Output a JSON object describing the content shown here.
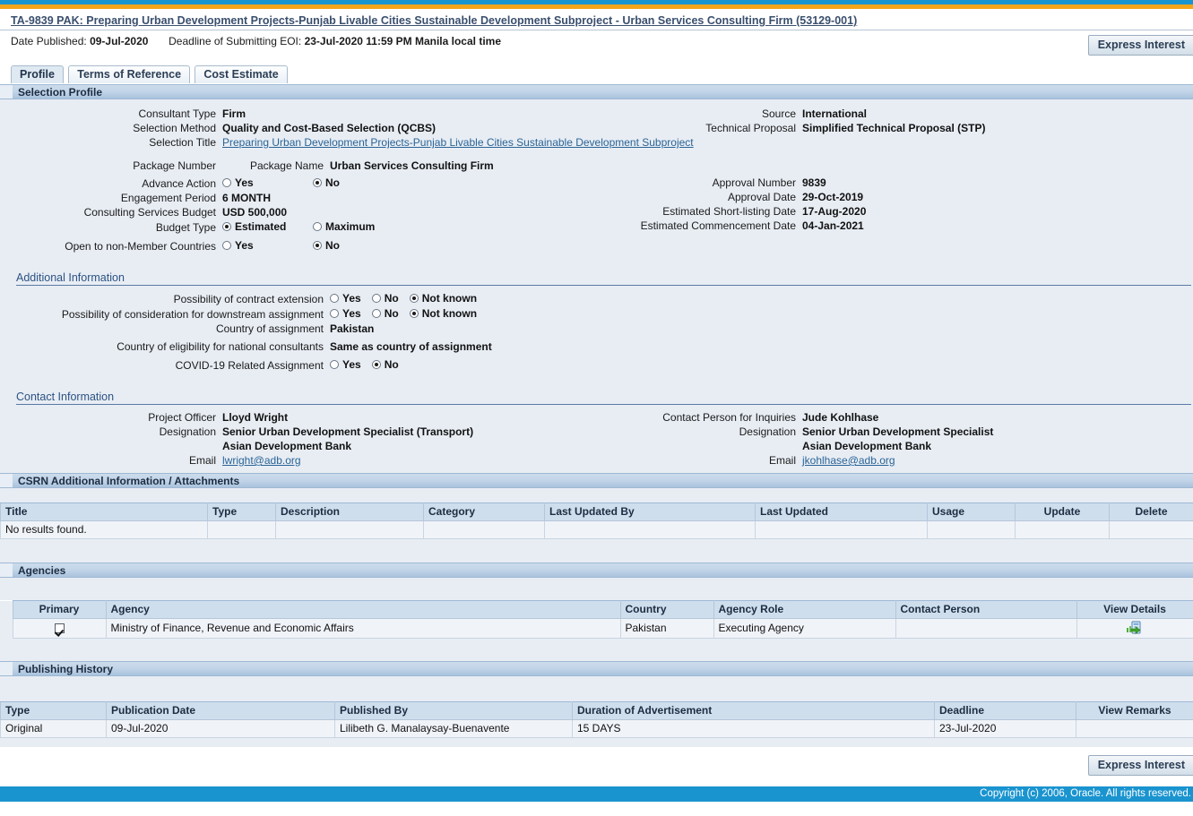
{
  "header": {
    "title": "TA-9839 PAK: Preparing Urban Development Projects-Punjab Livable Cities Sustainable Development Subproject - Urban Services Consulting Firm (53129-001)",
    "date_published_label": "Date Published:",
    "date_published_value": "09-Jul-2020",
    "deadline_label": "Deadline of Submitting EOI:",
    "deadline_value": "23-Jul-2020 11:59 PM Manila local time",
    "express_interest": "Express Interest"
  },
  "tabs": [
    {
      "label": "Profile",
      "active": true
    },
    {
      "label": "Terms of Reference",
      "active": false
    },
    {
      "label": "Cost Estimate",
      "active": false
    }
  ],
  "selection_profile": {
    "band": "Selection Profile",
    "left": {
      "consultant_type_label": "Consultant Type",
      "consultant_type_value": "Firm",
      "selection_method_label": "Selection Method",
      "selection_method_value": "Quality and Cost-Based Selection (QCBS)",
      "selection_title_label": "Selection Title",
      "selection_title_value": "Preparing Urban Development Projects-Punjab Livable Cities Sustainable Development Subproject",
      "package_number_label": "Package Number",
      "package_number_value": "",
      "package_name_label": "Package Name",
      "package_name_value": "Urban Services Consulting Firm",
      "advance_action_label": "Advance Action",
      "advance_action_yes": "Yes",
      "advance_action_no": "No",
      "advance_action_selected": "No",
      "engagement_period_label": "Engagement Period",
      "engagement_period_value": "6 MONTH",
      "budget_label": "Consulting Services Budget",
      "budget_value": "USD 500,000",
      "budget_type_label": "Budget Type",
      "budget_type_estimated": "Estimated",
      "budget_type_maximum": "Maximum",
      "budget_type_selected": "Estimated",
      "open_nonmember_label": "Open to non-Member Countries",
      "open_nonmember_yes": "Yes",
      "open_nonmember_no": "No",
      "open_nonmember_selected": "No"
    },
    "right": {
      "source_label": "Source",
      "source_value": "International",
      "technical_proposal_label": "Technical Proposal",
      "technical_proposal_value": "Simplified Technical Proposal (STP)",
      "approval_number_label": "Approval Number",
      "approval_number_value": "9839",
      "approval_date_label": "Approval Date",
      "approval_date_value": "29-Oct-2019",
      "shortlisting_label": "Estimated Short-listing Date",
      "shortlisting_value": "17-Aug-2020",
      "commencement_label": "Estimated Commencement Date",
      "commencement_value": "04-Jan-2021"
    }
  },
  "additional_information": {
    "title": "Additional Information",
    "contract_extension_label": "Possibility of contract extension",
    "contract_extension_options": [
      "Yes",
      "No",
      "Not known"
    ],
    "contract_extension_selected": "Not known",
    "downstream_label": "Possibility of consideration for downstream assignment",
    "downstream_options": [
      "Yes",
      "No",
      "Not known"
    ],
    "downstream_selected": "Not known",
    "country_assignment_label": "Country of assignment",
    "country_assignment_value": "Pakistan",
    "country_eligibility_label": "Country of eligibility for national consultants",
    "country_eligibility_value": "Same as country of assignment",
    "covid_label": "COVID-19 Related Assignment",
    "covid_options": [
      "Yes",
      "No"
    ],
    "covid_selected": "No"
  },
  "contact_information": {
    "title": "Contact Information",
    "left": {
      "officer_label": "Project Officer",
      "officer_value": "Lloyd Wright",
      "designation_label": "Designation",
      "designation_value": "Senior Urban Development Specialist (Transport)",
      "organization_value": "Asian Development Bank",
      "email_label": "Email",
      "email_value": "lwright@adb.org"
    },
    "right": {
      "contact_label": "Contact Person for Inquiries",
      "contact_value": "Jude Kohlhase",
      "designation_label": "Designation",
      "designation_value": "Senior Urban Development Specialist",
      "organization_value": "Asian Development Bank",
      "email_label": "Email",
      "email_value": "jkohlhase@adb.org"
    }
  },
  "csrn": {
    "band": "CSRN Additional Information / Attachments",
    "columns": [
      "Title",
      "Type",
      "Description",
      "Category",
      "Last Updated By",
      "Last Updated",
      "Usage",
      "Update",
      "Delete"
    ],
    "empty_message": "No results found.",
    "rows": []
  },
  "agencies": {
    "band": "Agencies",
    "columns": [
      "Primary",
      "Agency",
      "Country",
      "Agency Role",
      "Contact Person",
      "View Details"
    ],
    "rows": [
      {
        "primary": true,
        "agency": "Ministry of Finance, Revenue and Economic Affairs",
        "country": "Pakistan",
        "agency_role": "Executing Agency",
        "contact_person": "",
        "view_details_icon": "view-details-icon"
      }
    ]
  },
  "publishing_history": {
    "band": "Publishing History",
    "columns": [
      "Type",
      "Publication Date",
      "Published By",
      "Duration of Advertisement",
      "Deadline",
      "View Remarks"
    ],
    "rows": [
      {
        "type": "Original",
        "publication_date": "09-Jul-2020",
        "published_by": "Lilibeth G. Manalaysay-Buenavente",
        "duration": "15 DAYS",
        "deadline": "23-Jul-2020",
        "view_remarks": ""
      }
    ]
  },
  "footer": {
    "express_interest": "Express Interest",
    "copyright": "Copyright (c) 2006, Oracle. All rights reserved."
  },
  "colors": {
    "accent_blue": "#1a94cf",
    "accent_orange": "#f5a51a",
    "panel_bg": "#e8edf4",
    "band_blue": "#c3d5e8",
    "link": "#2a6496"
  }
}
